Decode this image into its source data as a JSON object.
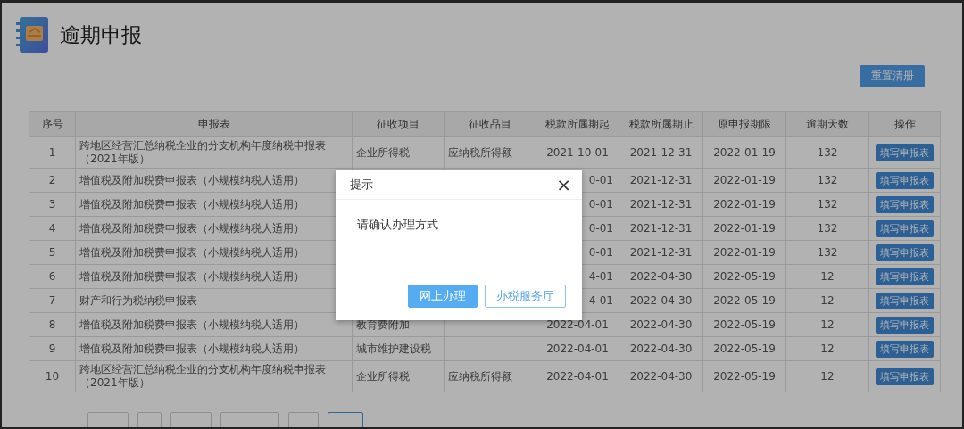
{
  "page": {
    "title": "逾期申报"
  },
  "toolbar": {
    "reset_button": "重置清册"
  },
  "table": {
    "columns": [
      "序号",
      "申报表",
      "征收项目",
      "征收品目",
      "税款所属期起",
      "税款所属期止",
      "原申报期限",
      "逾期天数",
      "操作"
    ],
    "rows": [
      {
        "no": "1",
        "form": "跨地区经营汇总纳税企业的分支机构年度纳税申报表（2021年版）",
        "item": "企业所得税",
        "subitem": "应纳税所得额",
        "start": "2021-10-01",
        "start_covered": false,
        "end": "2021-12-31",
        "deadline": "2022-01-19",
        "days": "132",
        "action": "填写申报表"
      },
      {
        "no": "2",
        "form": "增值税及附加税费申报表（小规模纳税人适用）",
        "start": "0-01",
        "start_covered": true,
        "end": "2021-12-31",
        "deadline": "2022-01-19",
        "days": "132",
        "action": "填写申报表"
      },
      {
        "no": "3",
        "form": "增值税及附加税费申报表（小规模纳税人适用）",
        "start": "0-01",
        "start_covered": true,
        "end": "2021-12-31",
        "deadline": "2022-01-19",
        "days": "132",
        "action": "填写申报表"
      },
      {
        "no": "4",
        "form": "增值税及附加税费申报表（小规模纳税人适用）",
        "start": "0-01",
        "start_covered": true,
        "end": "2021-12-31",
        "deadline": "2022-01-19",
        "days": "132",
        "action": "填写申报表"
      },
      {
        "no": "5",
        "form": "增值税及附加税费申报表（小规模纳税人适用）",
        "start": "0-01",
        "start_covered": true,
        "end": "2021-12-31",
        "deadline": "2022-01-19",
        "days": "132",
        "action": "填写申报表"
      },
      {
        "no": "6",
        "form": "增值税及附加税费申报表（小规模纳税人适用）",
        "start": "4-01",
        "start_covered": true,
        "end": "2022-04-30",
        "deadline": "2022-05-19",
        "days": "12",
        "action": "填写申报表"
      },
      {
        "no": "7",
        "form": "财产和行为税纳税申报表",
        "start": "4-01",
        "start_covered": true,
        "end": "2022-04-30",
        "deadline": "2022-05-19",
        "days": "12",
        "action": "填写申报表"
      },
      {
        "no": "8",
        "form": "增值税及附加税费申报表（小规模纳税人适用）",
        "item": "教育费附加",
        "start": "2022-04-01",
        "start_covered": false,
        "end": "2022-04-30",
        "deadline": "2022-05-19",
        "days": "12",
        "action": "填写申报表"
      },
      {
        "no": "9",
        "form": "增值税及附加税费申报表（小规模纳税人适用）",
        "item": "城市维护建设税",
        "start": "2022-04-01",
        "start_covered": false,
        "end": "2022-04-30",
        "deadline": "2022-05-19",
        "days": "12",
        "action": "填写申报表"
      },
      {
        "no": "10",
        "form": "跨地区经营汇总纳税企业的分支机构年度纳税申报表（2021年版）",
        "item": "企业所得税",
        "subitem": "应纳税所得额",
        "start": "2022-04-01",
        "start_covered": false,
        "end": "2022-04-30",
        "deadline": "2022-05-19",
        "days": "12",
        "action": "填写申报表"
      }
    ]
  },
  "dialog": {
    "title": "提示",
    "close": "×",
    "message": "请确认办理方式",
    "buttons": [
      {
        "label": "网上办理",
        "kind": "primary"
      },
      {
        "label": "办税服务厅",
        "kind": "secondary"
      }
    ]
  }
}
